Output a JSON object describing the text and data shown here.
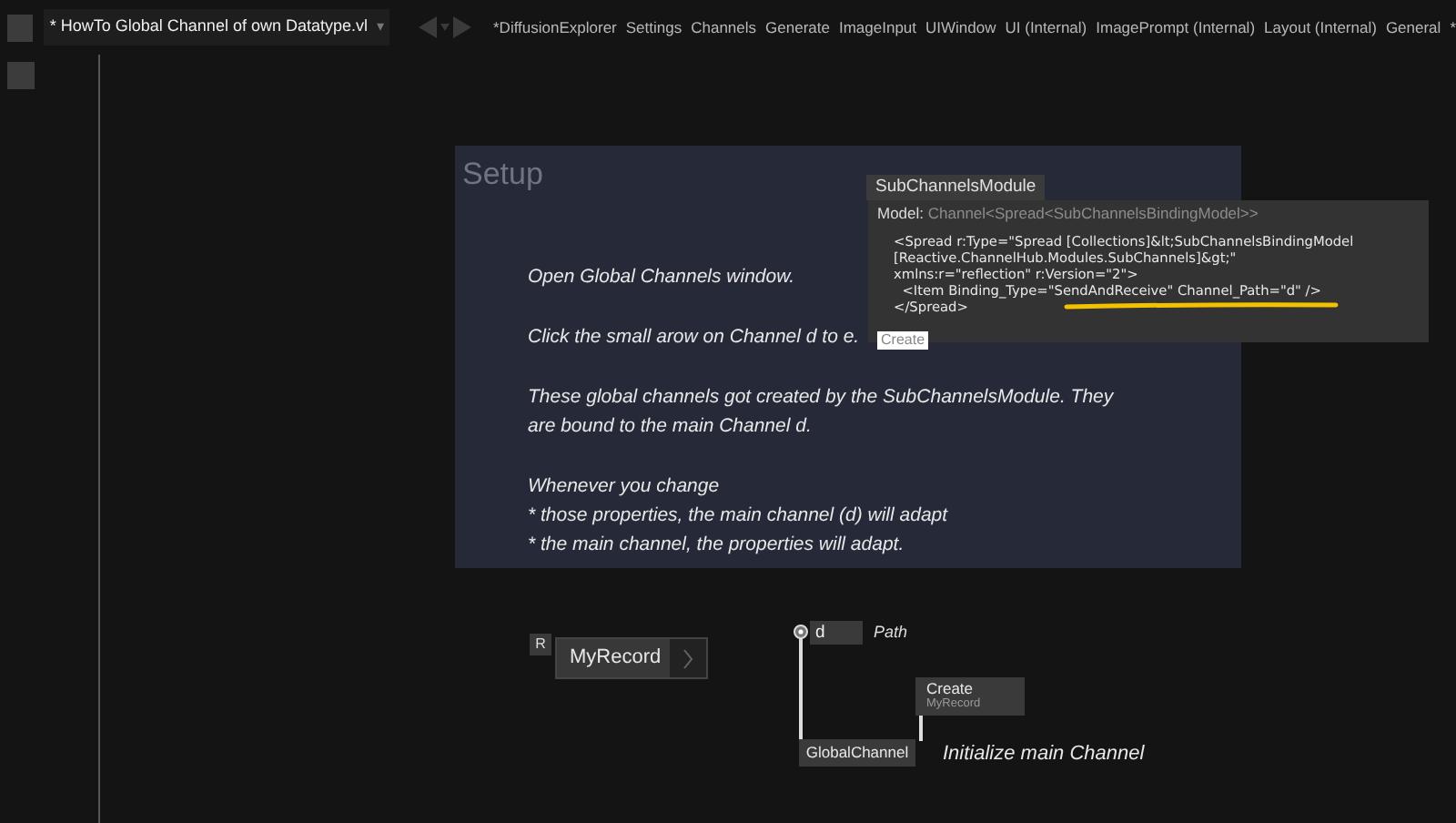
{
  "document_tab": {
    "label": "* HowTo Global Channel of own Datatype.vl",
    "selected": true,
    "dropdown": "▾"
  },
  "tabs": [
    {
      "label": "*DiffusionExplorer",
      "selected": false
    },
    {
      "label": "Settings",
      "selected": false
    },
    {
      "label": "Channels",
      "selected": false
    },
    {
      "label": "Generate",
      "selected": false
    },
    {
      "label": "ImageInput",
      "selected": false
    },
    {
      "label": "UIWindow",
      "selected": false
    },
    {
      "label": "UI (Internal)",
      "selected": false
    },
    {
      "label": "ImagePrompt (Internal)",
      "selected": false
    },
    {
      "label": "Layout (Internal)",
      "selected": false
    },
    {
      "label": "General",
      "selected": false
    },
    {
      "label": "*",
      "selected": false
    }
  ],
  "setup_panel": {
    "title": "Setup",
    "paragraphs": [
      [
        "Open Global Channels window."
      ],
      [
        "Click the small arow on Channel d to e."
      ],
      [
        "These global channels got created by the SubChannelsModule. They",
        "are bound to the main Channel d."
      ],
      [
        "Whenever you change",
        "* those properties, the main channel (d) will adapt",
        "* the main channel, the properties will adapt."
      ]
    ]
  },
  "tooltip": {
    "node": "SubChannelsModule",
    "model_label": "Model:",
    "model_type": "Channel<Spread<SubChannelsBindingModel>>",
    "xml_lines": [
      "<Spread r:Type=\"Spread [Collections]&lt;SubChannelsBindingModel",
      "[Reactive.ChannelHub.Modules.SubChannels]&gt;\"",
      "xmlns:r=\"reflection\" r:Version=\"2\">",
      "  <Item Binding_Type=\"SendAndReceive\" Channel_Path=\"d\" />",
      "</Spread>"
    ],
    "button": "Create"
  },
  "record_node": {
    "tag": "R",
    "name": "MyRecord"
  },
  "pad": {
    "value": "d",
    "comment": "Path"
  },
  "create_node": {
    "name": "Create",
    "subtitle": "MyRecord"
  },
  "global_node": {
    "name": "GlobalChannel"
  },
  "comment": "Initialize main Channel"
}
